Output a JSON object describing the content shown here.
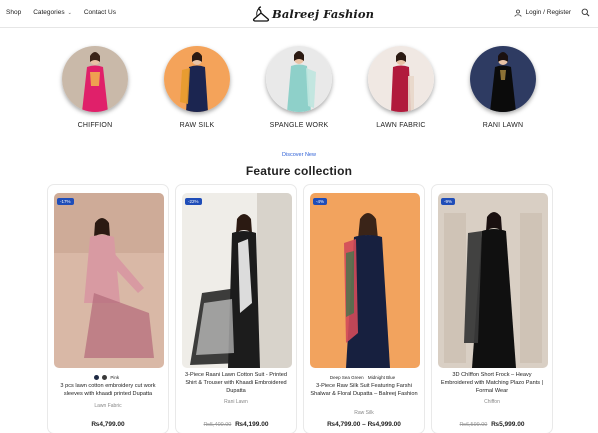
{
  "header": {
    "nav": [
      {
        "label": "Shop",
        "has_dropdown": false
      },
      {
        "label": "Categories",
        "has_dropdown": true
      },
      {
        "label": "Contact Us",
        "has_dropdown": false
      }
    ],
    "logo_text": "Balreej Fashion",
    "login_label": "Login / Register",
    "icons": {
      "login": "user-icon",
      "search": "search-icon",
      "logo": "hanger-icon"
    }
  },
  "categories": [
    {
      "label": "CHIFFION",
      "bg": "#c9b9a9",
      "dress": "#e0206a",
      "accent": "#f2c14a"
    },
    {
      "label": "RAW SILK",
      "bg": "#f4a35a",
      "dress": "#1b2550",
      "accent": "#e79b2c"
    },
    {
      "label": "SPANGLE WORK",
      "bg": "#e9e9e9",
      "dress": "#8ed0c9",
      "accent": "#bfe6df"
    },
    {
      "label": "LAWN FABRIC",
      "bg": "#f0e8e3",
      "dress": "#b11a3c",
      "accent": "#e8d7c9"
    },
    {
      "label": "RANI LAWN",
      "bg": "#2e3b62",
      "dress": "#0b0b0b",
      "accent": "#9a7c3a"
    }
  ],
  "section": {
    "kicker": "Discover New",
    "title": "Feature collection"
  },
  "products": [
    {
      "badge": "-17%",
      "swatches": [
        {
          "color": "#1f2a44",
          "label": ""
        },
        {
          "color": "#f0a4bf",
          "label": "Pink"
        }
      ],
      "title": "3 pcs lawn cotton embroidery cut work sleeves with khaadi printed Dupatta",
      "category": "Lawn Fabric",
      "old_price": "",
      "price": "₨4,799.00",
      "bg": "#d9b8a6",
      "dress": "#d89aa2",
      "accent": "#b56e7c"
    },
    {
      "badge": "-22%",
      "swatches": [],
      "title": "3-Piece Raani Lawn Cotton Suit - Printed Shirt & Trouser with Khaadi Embroidered Dupatta",
      "category": "Rani Lawn",
      "old_price": "₨5,400.00",
      "price": "₨4,199.00",
      "bg": "#efede8",
      "dress": "#1c1c1c",
      "accent": "#f2f2f2"
    },
    {
      "badge": "-4%",
      "swatches": [
        {
          "color": "",
          "label": "Deep Sea Green"
        },
        {
          "color": "",
          "label": "Midnight Blue"
        }
      ],
      "title": "3-Piece Raw Silk Suit Featuring Farshi Shalwar & Floral Dupatta – Balreej Fashion",
      "category": "Raw Silk",
      "old_price": "",
      "price": "₨4,799.00 – ₨4,999.00",
      "bg": "#f2a35e",
      "dress": "#17203f",
      "accent": "#d24a5a"
    },
    {
      "badge": "-9%",
      "swatches": [],
      "title": "3D ChIffon Short Frock – Heavy Embroidered with Matching Plazo Pants | Formal Wear",
      "category": "Chiffon",
      "old_price": "₨6,599.00",
      "price": "₨5,999.00",
      "bg": "#d9cfc4",
      "dress": "#101010",
      "accent": "#3a3a3a"
    }
  ],
  "colors": {
    "accent_blue": "#1f4db8",
    "link_blue": "#2c5fd6"
  }
}
